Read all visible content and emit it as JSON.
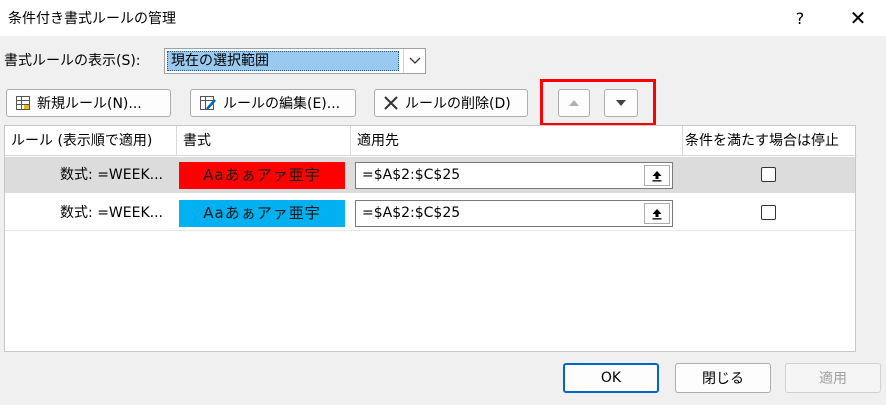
{
  "window": {
    "title": "条件付き書式ルールの管理",
    "help_label": "?",
    "close_label": "✕"
  },
  "show_rules": {
    "label": "書式ルールの表示(S):",
    "selected": "現在の選択範囲"
  },
  "toolbar": {
    "new_rule": "新規ルール(N)...",
    "edit_rule": "ルールの編集(E)...",
    "delete_rule": "ルールの削除(D)"
  },
  "table": {
    "headers": {
      "rule": "ルール (表示順で適用)",
      "format": "書式",
      "applies_to": "適用先",
      "stop_if_true": "条件を満たす場合は停止"
    },
    "rows": [
      {
        "rule": "数式: =WEEK...",
        "preview": "Aaあぁアァ亜宇",
        "preview_bg": "#ff0000",
        "preview_color": "#1a1a1a",
        "applies_to": "=$A$2:$C$25",
        "stop": false,
        "selected": true
      },
      {
        "rule": "数式: =WEEK...",
        "preview": "Aaあぁアァ亜宇",
        "preview_bg": "#00b0f0",
        "preview_color": "#1a1a1a",
        "applies_to": "=$A$2:$C$25",
        "stop": false,
        "selected": false
      }
    ]
  },
  "footer": {
    "ok": "OK",
    "close": "閉じる",
    "apply": "適用"
  },
  "colors": {
    "highlight": "#ff0000",
    "selection": "#99c9ef"
  }
}
